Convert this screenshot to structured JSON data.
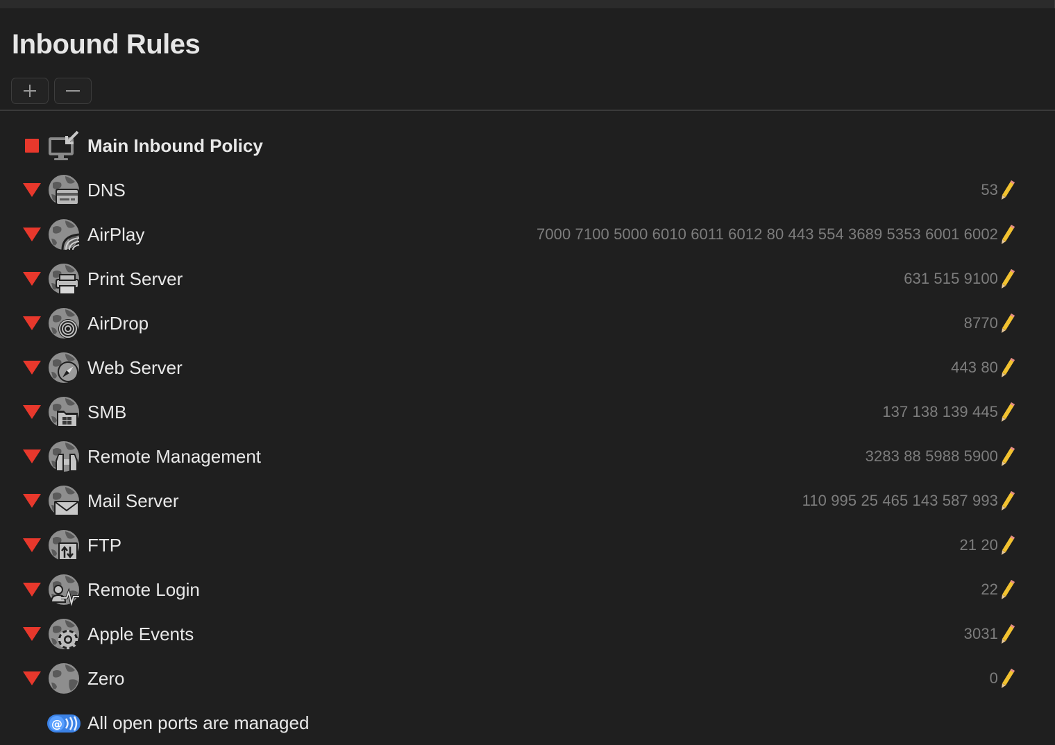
{
  "window": {
    "title": "Inbound Rules",
    "add_button_symbol": "+",
    "remove_button_symbol": "−"
  },
  "colors": {
    "background": "#1f1f1f",
    "accent_red": "#e8382c",
    "port_text": "#7d7d7d",
    "label_text": "#e8e8e8"
  },
  "policy": {
    "label": "Main Inbound Policy",
    "marker": "red-square",
    "icon": "computer-inbound-icon"
  },
  "rules": [
    {
      "label": "DNS",
      "ports": "53",
      "icon": "dns-icon"
    },
    {
      "label": "AirPlay",
      "ports": "7000 7100 5000 6010 6011 6012 80 443 554 3689 5353 6001 6002",
      "icon": "airplay-icon"
    },
    {
      "label": "Print Server",
      "ports": "631 515 9100",
      "icon": "printer-icon"
    },
    {
      "label": "AirDrop",
      "ports": "8770",
      "icon": "airdrop-icon"
    },
    {
      "label": "Web Server",
      "ports": "443 80",
      "icon": "compass-icon"
    },
    {
      "label": "SMB",
      "ports": "137 138 139 445",
      "icon": "windows-folder-icon"
    },
    {
      "label": "Remote Management",
      "ports": "3283 88 5988 5900",
      "icon": "binoculars-icon"
    },
    {
      "label": "Mail Server",
      "ports": "110 995 25 465 143 587 993",
      "icon": "envelope-icon"
    },
    {
      "label": "FTP",
      "ports": "21 20",
      "icon": "transfer-icon"
    },
    {
      "label": "Remote Login",
      "ports": "22",
      "icon": "remote-login-icon"
    },
    {
      "label": "Apple Events",
      "ports": "3031",
      "icon": "gear-icon"
    },
    {
      "label": "Zero",
      "ports": "0",
      "icon": "globe-icon"
    }
  ],
  "footer": {
    "label": "All open ports are managed",
    "icon": "at-signal-icon"
  }
}
